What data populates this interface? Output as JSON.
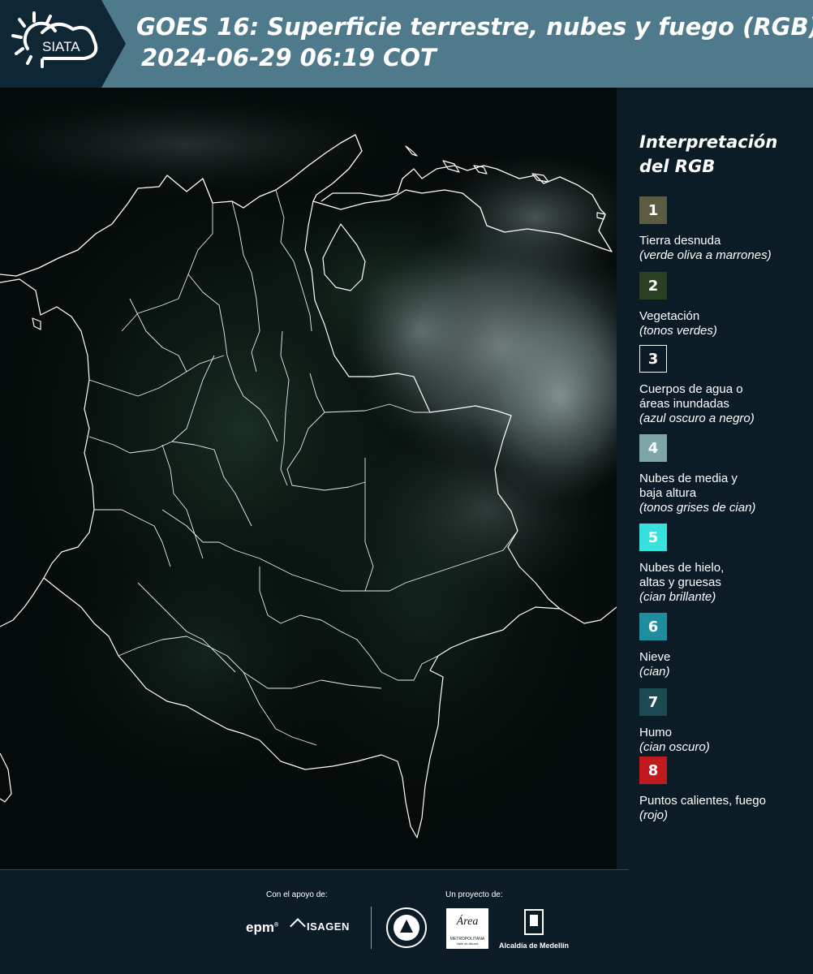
{
  "header": {
    "logo_text": "SIATA",
    "title_line1": "GOES 16: Superficie terrestre, nubes y fuego (RGB)",
    "title_line2": "2024-06-29 06:19 COT"
  },
  "legend": {
    "title": "Interpretación del RGB",
    "items": [
      {
        "num": "1",
        "name": "Tierra desnuda",
        "desc": "(verde oliva a marrones)",
        "color": "#5c5c42"
      },
      {
        "num": "2",
        "name": "Vegetación",
        "desc": "(tonos verdes)",
        "color": "#2b3f22"
      },
      {
        "num": "3",
        "name": "Cuerpos de agua o\náreas inundadas",
        "desc": "(azul oscuro a negro)",
        "color": "#0c1c27"
      },
      {
        "num": "4",
        "name": "Nubes de media y\nbaja altura",
        "desc": "(tonos grises de cian)",
        "color": "#7fa6a6"
      },
      {
        "num": "5",
        "name": "Nubes de hielo,\naltas y gruesas",
        "desc": "(cian brillante)",
        "color": "#38e0de"
      },
      {
        "num": "6",
        "name": "Nieve",
        "desc": "(cian)",
        "color": "#1f8da0"
      },
      {
        "num": "7",
        "name": "Humo",
        "desc": "(cian oscuro)",
        "color": "#1b4a52"
      },
      {
        "num": "8",
        "name": "Puntos calientes, fuego",
        "desc": "(rojo)",
        "color": "#c0191e"
      }
    ]
  },
  "footer": {
    "support_label": "Con el apoyo de:",
    "project_label": "Un proyecto de:",
    "sponsor_epm": "epm",
    "sponsor_isagen": "ISAGEN",
    "sponsor_area_main": "Área",
    "sponsor_area_sub": "METROPOLITANA",
    "sponsor_area_sub2": "Valle de Aburrá",
    "sponsor_alcaldia": "Alcaldía de Medellín"
  },
  "colors": {
    "header_bar": "#4e7a8b",
    "header_logo_bg": "#0f2634",
    "page_bg": "#0c1c27"
  }
}
